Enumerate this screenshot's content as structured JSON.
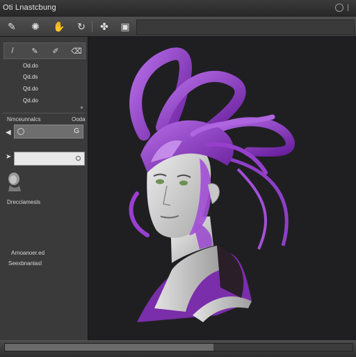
{
  "window": {
    "title": "Oti Lnastcbung"
  },
  "toolbar": {
    "tools": [
      {
        "icon": "sculpt-brush-icon",
        "glyph": "✎"
      },
      {
        "icon": "smooth-brush-icon",
        "glyph": "✺"
      },
      {
        "icon": "move-brush-icon",
        "glyph": "✋"
      },
      {
        "icon": "rotate-icon",
        "glyph": "↻"
      },
      {
        "icon": "transpose-icon",
        "glyph": "✤"
      },
      {
        "icon": "layer-icon",
        "glyph": "▣"
      }
    ]
  },
  "left_panel": {
    "mini_tools": [
      {
        "icon": "brush-icon",
        "glyph": "/"
      },
      {
        "icon": "pencil-icon",
        "glyph": "✎"
      },
      {
        "icon": "pen-icon",
        "glyph": "✐"
      },
      {
        "icon": "eraser-icon",
        "glyph": "⌫"
      }
    ],
    "list_items": [
      "Od.do",
      "Qd.ds",
      "Qd.do",
      "Qd.do"
    ],
    "section_header": {
      "label": "Nmceunnalcs",
      "value": "Ooda"
    },
    "dropdown": {
      "glyph": "G"
    },
    "text_field": {
      "value": ""
    },
    "thumbnail_label": "Drecclamesls",
    "info_line_1": "Arnoanoer.ed",
    "info_line_2": "Seexbnanlasl"
  },
  "colors": {
    "accent": "#a050c8",
    "hair": "#9b3fd1",
    "skin": "#dcdcdc",
    "panel": "#3a3a3b",
    "viewport": "#1f1f22"
  }
}
